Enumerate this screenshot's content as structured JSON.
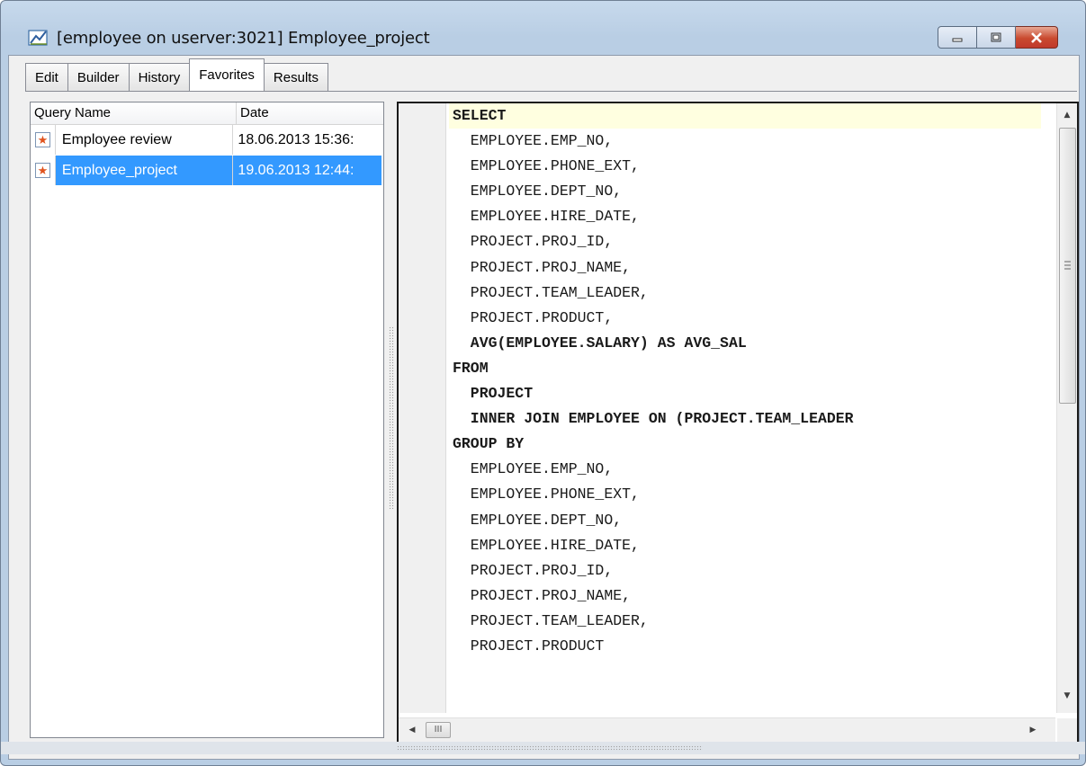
{
  "window": {
    "title": "[employee on userver:3021] Employee_project",
    "icon": "query-builder-icon"
  },
  "tabs": [
    {
      "label": "Edit",
      "active": false
    },
    {
      "label": "Builder",
      "active": false
    },
    {
      "label": "History",
      "active": false
    },
    {
      "label": "Favorites",
      "active": true
    },
    {
      "label": "Results",
      "active": false
    }
  ],
  "favorites": {
    "columns": {
      "name": "Query Name",
      "date": "Date"
    },
    "rows": [
      {
        "name": "Employee review",
        "date": "18.06.2013 15:36:",
        "icon": "star-icon",
        "selected": false
      },
      {
        "name": "Employee_project",
        "date": "19.06.2013 12:44:",
        "icon": "star-icon",
        "selected": true
      }
    ]
  },
  "editor": {
    "lines": [
      {
        "text": "SELECT",
        "keyword": true
      },
      {
        "text": "  EMPLOYEE.EMP_NO,",
        "keyword": false
      },
      {
        "text": "  EMPLOYEE.PHONE_EXT,",
        "keyword": false
      },
      {
        "text": "  EMPLOYEE.DEPT_NO,",
        "keyword": false
      },
      {
        "text": "  EMPLOYEE.HIRE_DATE,",
        "keyword": false
      },
      {
        "text": "  PROJECT.PROJ_ID,",
        "keyword": false
      },
      {
        "text": "  PROJECT.PROJ_NAME,",
        "keyword": false
      },
      {
        "text": "  PROJECT.TEAM_LEADER,",
        "keyword": false
      },
      {
        "text": "  PROJECT.PRODUCT,",
        "keyword": false
      },
      {
        "text": "  AVG(EMPLOYEE.SALARY) AS AVG_SAL",
        "keyword": true
      },
      {
        "text": "FROM",
        "keyword": true
      },
      {
        "text": "  PROJECT",
        "keyword": true
      },
      {
        "text": "  INNER JOIN EMPLOYEE ON (PROJECT.TEAM_LEADER",
        "keyword": true
      },
      {
        "text": "GROUP BY",
        "keyword": true
      },
      {
        "text": "  EMPLOYEE.EMP_NO,",
        "keyword": false
      },
      {
        "text": "  EMPLOYEE.PHONE_EXT,",
        "keyword": false
      },
      {
        "text": "  EMPLOYEE.DEPT_NO,",
        "keyword": false
      },
      {
        "text": "  EMPLOYEE.HIRE_DATE,",
        "keyword": false
      },
      {
        "text": "  PROJECT.PROJ_ID,",
        "keyword": false
      },
      {
        "text": "  PROJECT.PROJ_NAME,",
        "keyword": false
      },
      {
        "text": "  PROJECT.TEAM_LEADER,",
        "keyword": false
      },
      {
        "text": "  PROJECT.PRODUCT",
        "keyword": false
      }
    ],
    "hscroll_thumb_label": "III"
  }
}
